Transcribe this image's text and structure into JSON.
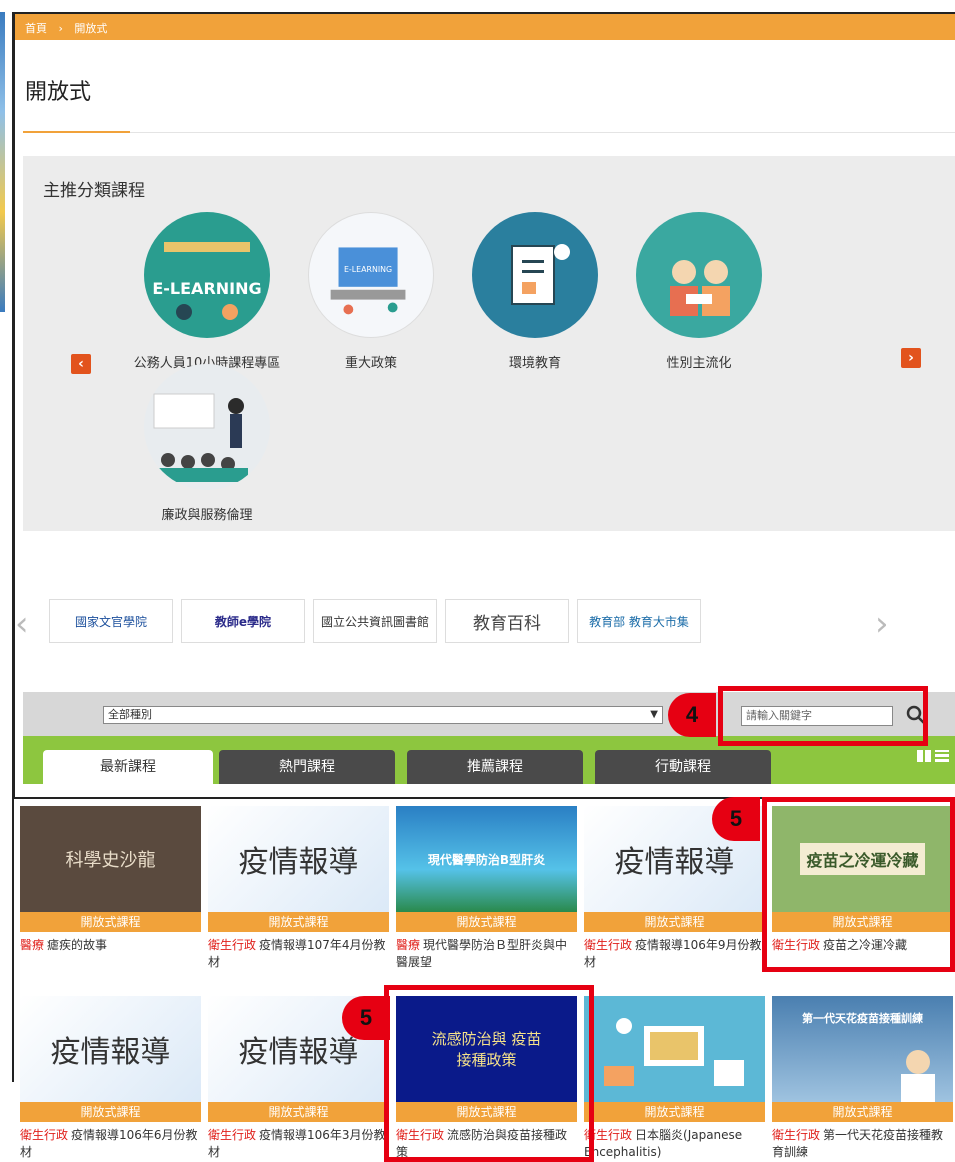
{
  "breadcrumb": {
    "home": "首頁",
    "separator": "›",
    "current": "開放式"
  },
  "page_title": "開放式",
  "featured": {
    "title": "主推分類課程",
    "categories": [
      {
        "label": "公務人員10小時課程專區",
        "art": "E-LEARNING"
      },
      {
        "label": "重大政策",
        "art": "E-LEARNING"
      },
      {
        "label": "環境教育",
        "art": ""
      },
      {
        "label": "性別主流化",
        "art": ""
      },
      {
        "label": "廉政與服務倫理",
        "art": ""
      }
    ],
    "prev_icon": "chevron-left-icon",
    "next_icon": "chevron-right-icon"
  },
  "partners": [
    {
      "name": "國家文官學院"
    },
    {
      "name": "教師e學院"
    },
    {
      "name": "國立公共資訊圖書館"
    },
    {
      "name": "教育百科"
    },
    {
      "name": "教育部 教育大市集"
    }
  ],
  "search": {
    "category_value": "全部種別",
    "keyword_placeholder": "請輸入關鍵字"
  },
  "tabs": [
    "最新課程",
    "熱門課程",
    "推薦課程",
    "行動課程"
  ],
  "annotations": {
    "marker_4": "4",
    "marker_5a": "5",
    "marker_5b": "5"
  },
  "courses": [
    {
      "badge": "開放式課程",
      "category": "醫療",
      "title": "瘧疾的故事",
      "thumb_text": "科學史沙龍"
    },
    {
      "badge": "開放式課程",
      "category": "衛生行政",
      "title": "疫情報導107年4月份教材",
      "thumb_text": "疫情報導"
    },
    {
      "badge": "開放式課程",
      "category": "醫療",
      "title": "現代醫學防治Ｂ型肝炎與中醫展望",
      "thumb_text": "現代醫學防治B型肝炎"
    },
    {
      "badge": "開放式課程",
      "category": "衛生行政",
      "title": "疫情報導106年9月份教材",
      "thumb_text": "疫情報導"
    },
    {
      "badge": "開放式課程",
      "category": "衛生行政",
      "title": "疫苗之冷運冷藏",
      "thumb_text": "疫苗之冷運冷藏"
    },
    {
      "badge": "開放式課程",
      "category": "衛生行政",
      "title": "疫情報導106年6月份教材",
      "thumb_text": "疫情報導"
    },
    {
      "badge": "開放式課程",
      "category": "衛生行政",
      "title": "疫情報導106年3月份教材",
      "thumb_text": "疫情報導"
    },
    {
      "badge": "開放式課程",
      "category": "衛生行政",
      "title": "流感防治與疫苗接種政策",
      "thumb_text": "流感防治與 疫苗接種政策"
    },
    {
      "badge": "開放式課程",
      "category": "衛生行政",
      "title": "日本腦炎(Japanese Encephalitis)",
      "thumb_text": ""
    },
    {
      "badge": "開放式課程",
      "category": "衛生行政",
      "title": "第一代天花疫苗接種教育訓練",
      "thumb_text": "第一代天花疫苗接種訓練"
    }
  ],
  "colors": {
    "accent": "#f1a23a",
    "green": "#8dc63f",
    "tag_red": "#e0201b",
    "marker_red": "#e60012"
  }
}
